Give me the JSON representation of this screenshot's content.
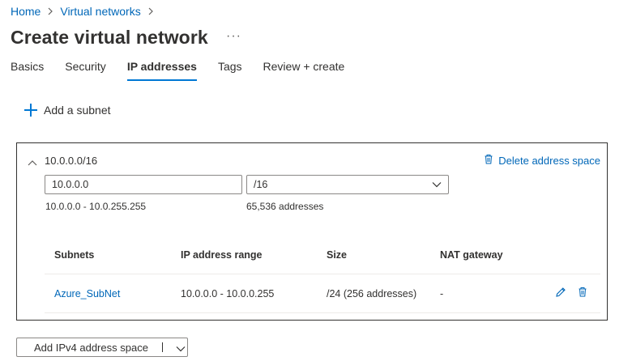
{
  "breadcrumb": {
    "items": [
      "Home",
      "Virtual networks"
    ]
  },
  "page": {
    "title": "Create virtual network",
    "more_label": "···"
  },
  "tabs": [
    {
      "label": "Basics",
      "active": false
    },
    {
      "label": "Security",
      "active": false
    },
    {
      "label": "IP addresses",
      "active": true
    },
    {
      "label": "Tags",
      "active": false
    },
    {
      "label": "Review + create",
      "active": false
    }
  ],
  "toolbar": {
    "add_subnet_label": "Add a subnet"
  },
  "address_space": {
    "name": "10.0.0.0/16",
    "delete_label": "Delete address space",
    "ip_value": "10.0.0.0",
    "cidr_value": "/16",
    "range_text": "10.0.0.0 - 10.0.255.255",
    "count_text": "65,536 addresses"
  },
  "subnet_table": {
    "headers": [
      "Subnets",
      "IP address range",
      "Size",
      "NAT gateway"
    ],
    "rows": [
      {
        "name": "Azure_SubNet",
        "range": "10.0.0.0 - 10.0.0.255",
        "size": "/24 (256 addresses)",
        "nat": "-"
      }
    ]
  },
  "footer": {
    "add_space_label": "Add IPv4 address space"
  },
  "colors": {
    "accent": "#0078d4",
    "link": "#0067b8",
    "text": "#323130",
    "border": "#8a8886"
  }
}
